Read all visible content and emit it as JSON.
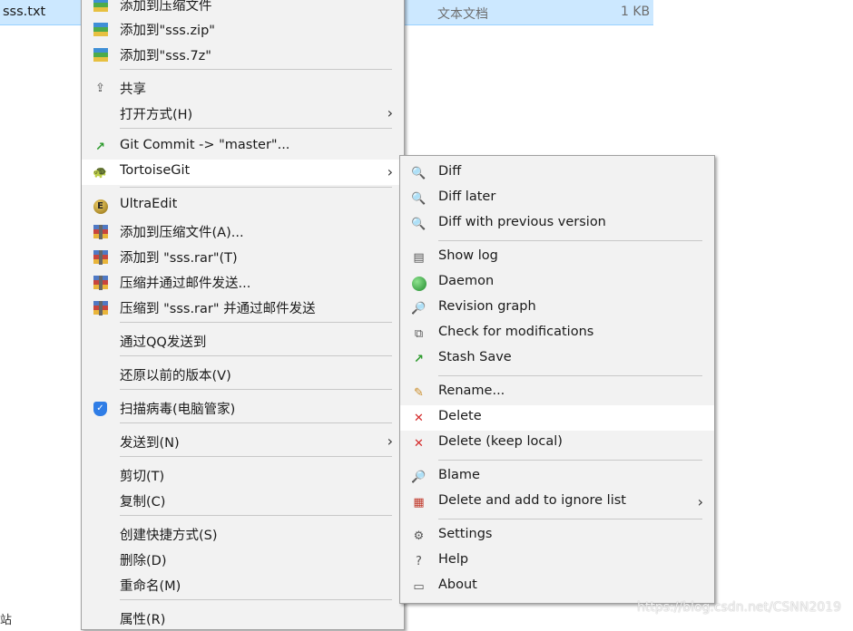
{
  "explorer": {
    "file_name": "sss.txt",
    "file_type": "文本文档",
    "file_size": "1 KB",
    "stray_text": "站",
    "watermark": "https://blog.csdn.net/CSNN2019"
  },
  "main_menu": {
    "items": [
      {
        "label": "添加到压缩文件",
        "icon": "zip-archive-icon"
      },
      {
        "label": "添加到\"sss.zip\"",
        "icon": "zip-archive-icon"
      },
      {
        "label": "添加到\"sss.7z\"",
        "icon": "zip-archive-icon"
      },
      {
        "label": "共享",
        "icon": "share-icon"
      },
      {
        "label": "打开方式(H)",
        "icon": ""
      },
      {
        "label": "Git Commit -> \"master\"...",
        "icon": "git-commit-icon"
      },
      {
        "label": "TortoiseGit",
        "icon": "tortoise-icon"
      },
      {
        "label": "UltraEdit",
        "icon": "ultraedit-icon"
      },
      {
        "label": "添加到压缩文件(A)...",
        "icon": "winrar-icon"
      },
      {
        "label": "添加到 \"sss.rar\"(T)",
        "icon": "winrar-icon"
      },
      {
        "label": "压缩并通过邮件发送...",
        "icon": "winrar-icon"
      },
      {
        "label": "压缩到 \"sss.rar\" 并通过邮件发送",
        "icon": "winrar-icon"
      },
      {
        "label": "通过QQ发送到",
        "icon": ""
      },
      {
        "label": "还原以前的版本(V)",
        "icon": ""
      },
      {
        "label": "扫描病毒(电脑管家)",
        "icon": "shield-icon"
      },
      {
        "label": "发送到(N)",
        "icon": ""
      },
      {
        "label": "剪切(T)",
        "icon": ""
      },
      {
        "label": "复制(C)",
        "icon": ""
      },
      {
        "label": "创建快捷方式(S)",
        "icon": ""
      },
      {
        "label": "删除(D)",
        "icon": ""
      },
      {
        "label": "重命名(M)",
        "icon": ""
      },
      {
        "label": "属性(R)",
        "icon": ""
      }
    ]
  },
  "sub_menu": {
    "items": [
      {
        "label": "Diff",
        "icon": "diff-icon"
      },
      {
        "label": "Diff later",
        "icon": "diff-later-icon"
      },
      {
        "label": "Diff with previous version",
        "icon": "diff-previous-icon"
      },
      {
        "label": "Show log",
        "icon": "show-log-icon"
      },
      {
        "label": "Daemon",
        "icon": "daemon-globe-icon"
      },
      {
        "label": "Revision graph",
        "icon": "revision-graph-icon"
      },
      {
        "label": "Check for modifications",
        "icon": "check-modifications-icon"
      },
      {
        "label": "Stash Save",
        "icon": "stash-save-icon"
      },
      {
        "label": "Rename...",
        "icon": "rename-pencil-icon"
      },
      {
        "label": "Delete",
        "icon": "delete-x-icon"
      },
      {
        "label": "Delete (keep local)",
        "icon": "delete-keep-local-x-icon"
      },
      {
        "label": "Blame",
        "icon": "blame-icon"
      },
      {
        "label": "Delete and add to ignore list",
        "icon": "ignore-list-icon"
      },
      {
        "label": "Settings",
        "icon": "settings-icon"
      },
      {
        "label": "Help",
        "icon": "help-icon"
      },
      {
        "label": "About",
        "icon": "about-icon"
      }
    ]
  },
  "colors": {
    "selection": "#cce8ff",
    "menu_bg": "#f2f2f2",
    "hover_bg": "#ffffff"
  }
}
